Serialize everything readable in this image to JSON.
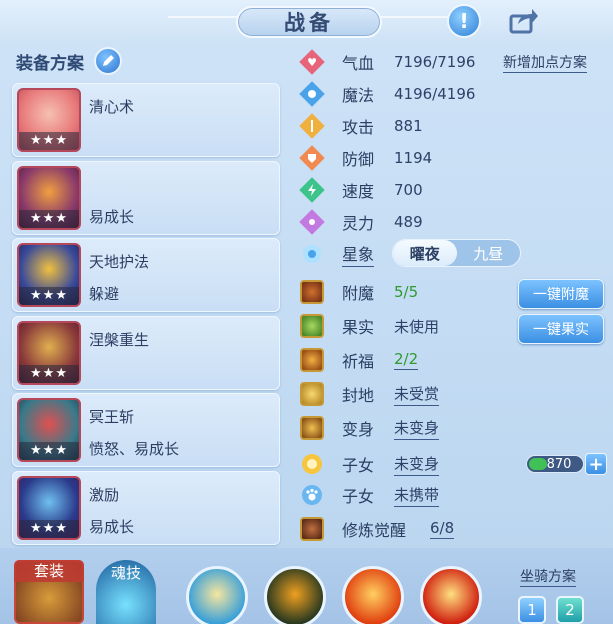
{
  "header": {
    "title": "战备",
    "help_icon": "exclamation-icon",
    "share_icon": "share-icon"
  },
  "equip": {
    "heading": "装备方案",
    "cards": [
      {
        "name": "清心术",
        "sub": "",
        "stars": "★★★",
        "color": "#e8787a"
      },
      {
        "name": "",
        "sub": "易成长",
        "stars": "★★★",
        "color": "#8a3a6a"
      },
      {
        "name": "天地护法",
        "sub": "躲避",
        "stars": "★★★",
        "color": "#3a4a9a"
      },
      {
        "name": "涅槃重生",
        "sub": "",
        "stars": "★★★",
        "color": "#8a3a3a"
      },
      {
        "name": "冥王斩",
        "sub": "愤怒、易成长",
        "stars": "★★★",
        "color": "#3a7a8a"
      },
      {
        "name": "激励",
        "sub": "易成长",
        "stars": "★★★",
        "color": "#2a3a8a"
      }
    ]
  },
  "stats": {
    "add_points": "新增加点方案",
    "hp": {
      "label": "气血",
      "value": "7196/7196"
    },
    "mp": {
      "label": "魔法",
      "value": "4196/4196"
    },
    "atk": {
      "label": "攻击",
      "value": "881"
    },
    "def": {
      "label": "防御",
      "value": "1194"
    },
    "spd": {
      "label": "速度",
      "value": "700"
    },
    "spi": {
      "label": "灵力",
      "value": "489"
    },
    "star": {
      "label": "星象",
      "options": [
        "曜夜",
        "九昼"
      ],
      "selected": "曜夜"
    }
  },
  "extras": {
    "enchant": {
      "label": "附魔",
      "value": "5/5"
    },
    "fruit": {
      "label": "果实",
      "value": "未使用"
    },
    "bless": {
      "label": "祈福",
      "value": "2/2"
    },
    "fief": {
      "label": "封地",
      "value": "未受赏"
    },
    "morph": {
      "label": "变身",
      "value": "未变身"
    },
    "child1": {
      "label": "子女",
      "value": "未变身"
    },
    "child2": {
      "label": "子女",
      "value": "未携带"
    },
    "awaken": {
      "label": "修炼觉醒",
      "value": "6/8"
    },
    "btn_enchant": "一键附魔",
    "btn_fruit": "一键果实",
    "currency": "870"
  },
  "bottom": {
    "suit": "套装",
    "soul": "魂技",
    "mount_label": "坐骑方案",
    "mounts": [
      "1",
      "2"
    ],
    "mount_selected": "2"
  }
}
